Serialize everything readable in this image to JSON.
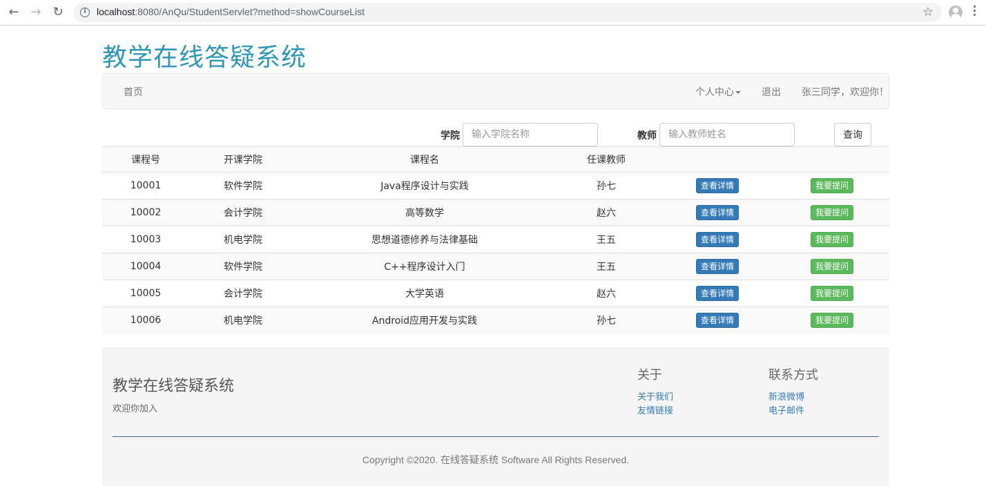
{
  "browser": {
    "url_host": "localhost",
    "url_rest": ":8080/AnQu/StudentServlet?method=showCourseList",
    "back_icon": "arrow-left-icon",
    "forward_icon": "arrow-right-icon",
    "reload_icon": "reload-icon"
  },
  "site": {
    "title": "教学在线答疑系统",
    "accent_color": "#2f97b5"
  },
  "navbar": {
    "home": "首页",
    "personal_center": "个人中心",
    "logout": "退出",
    "welcome": "张三同学，欢迎你！"
  },
  "search": {
    "college_label": "学院",
    "college_placeholder": "输入学院名称",
    "teacher_label": "教师",
    "teacher_placeholder": "输入教师姓名",
    "query_button": "查询"
  },
  "table": {
    "headers": [
      "课程号",
      "开课学院",
      "课程名",
      "任课教师",
      "",
      ""
    ],
    "detail_label": "查看详情",
    "ask_label": "我要提问",
    "rows": [
      [
        "10001",
        "软件学院",
        "Java程序设计与实践",
        "孙七"
      ],
      [
        "10002",
        "会计学院",
        "高等数学",
        "赵六"
      ],
      [
        "10003",
        "机电学院",
        "思想道德修养与法律基础",
        "王五"
      ],
      [
        "10004",
        "软件学院",
        "C++程序设计入门",
        "王五"
      ],
      [
        "10005",
        "会计学院",
        "大学英语",
        "赵六"
      ],
      [
        "10006",
        "机电学院",
        "Android应用开发与实践",
        "孙七"
      ]
    ]
  },
  "footer": {
    "title": "教学在线答疑系统",
    "subtitle": "欢迎你加入",
    "about_title": "关于",
    "about_links": [
      "关于我们",
      "友情链接"
    ],
    "contact_title": "联系方式",
    "contact_links": [
      "新浪微博",
      "电子邮件"
    ],
    "copyright": "Copyright ©2020. 在线答疑系统 Software All Rights Reserved."
  }
}
